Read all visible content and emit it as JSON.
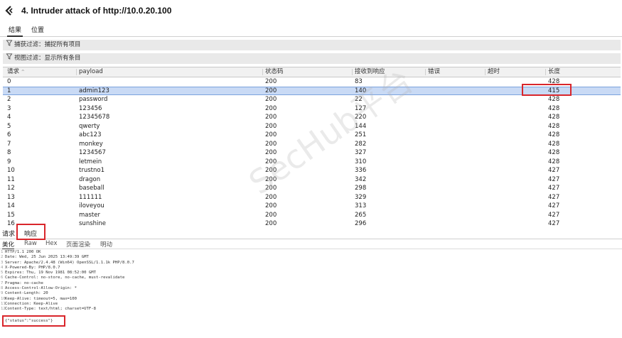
{
  "window": {
    "title": "4. Intruder attack of http://10.0.20.100"
  },
  "tabs": [
    "结果",
    "位置"
  ],
  "filters": {
    "capture": "捕获过滤：捕捉所有项目",
    "view": "视图过滤：显示所有条目"
  },
  "table": {
    "headers": [
      "请求",
      "payload",
      "状态码",
      "接收到响应",
      "错误",
      "超时",
      "长度"
    ],
    "sort_indicator": "^",
    "selected_index": 1,
    "rows": [
      [
        "0",
        "",
        "200",
        "83",
        "",
        "",
        "428"
      ],
      [
        "1",
        "admin123",
        "200",
        "140",
        "",
        "",
        "415"
      ],
      [
        "2",
        "password",
        "200",
        "22",
        "",
        "",
        "428"
      ],
      [
        "3",
        "123456",
        "200",
        "127",
        "",
        "",
        "428"
      ],
      [
        "4",
        "12345678",
        "200",
        "220",
        "",
        "",
        "428"
      ],
      [
        "5",
        "qwerty",
        "200",
        "144",
        "",
        "",
        "428"
      ],
      [
        "6",
        "abc123",
        "200",
        "251",
        "",
        "",
        "428"
      ],
      [
        "7",
        "monkey",
        "200",
        "282",
        "",
        "",
        "428"
      ],
      [
        "8",
        "1234567",
        "200",
        "327",
        "",
        "",
        "428"
      ],
      [
        "9",
        "letmein",
        "200",
        "310",
        "",
        "",
        "428"
      ],
      [
        "10",
        "trustno1",
        "200",
        "336",
        "",
        "",
        "427"
      ],
      [
        "11",
        "dragon",
        "200",
        "342",
        "",
        "",
        "427"
      ],
      [
        "12",
        "baseball",
        "200",
        "298",
        "",
        "",
        "427"
      ],
      [
        "13",
        "111111",
        "200",
        "329",
        "",
        "",
        "427"
      ],
      [
        "14",
        "iloveyou",
        "200",
        "313",
        "",
        "",
        "427"
      ],
      [
        "15",
        "master",
        "200",
        "265",
        "",
        "",
        "427"
      ],
      [
        "16",
        "sunshine",
        "200",
        "296",
        "",
        "",
        "427"
      ]
    ]
  },
  "watermark": "SecHub平台",
  "bottom_tabs": [
    "请求",
    "响应"
  ],
  "sub_tabs": [
    "美化",
    "Raw",
    "Hex",
    "页面渲染",
    "明动"
  ],
  "response": {
    "lines": [
      "HTTP/1.1 200 OK",
      "Date: Wed, 25 Jun 2025 13:49:39 GMT",
      "Server: Apache/2.4.48 (Win64) OpenSSL/1.1.1k PHP/8.0.7",
      "X-Powered-By: PHP/8.0.7",
      "Expires: Thu, 19 Nov 1981 08:52:00 GMT",
      "Cache-Control: no-store, no-cache, must-revalidate",
      "Pragma: no-cache",
      "Access-Control-Allow-Origin: *",
      "Content-Length: 20",
      "Keep-Alive: timeout=5, max=100",
      "Connection: Keep-Alive",
      "Content-Type: text/html; charset=UTF-8"
    ],
    "body": "{\"status\":\"success\"}"
  },
  "colors": {
    "highlight": "#d9262b",
    "selection": "#c9daf5"
  }
}
